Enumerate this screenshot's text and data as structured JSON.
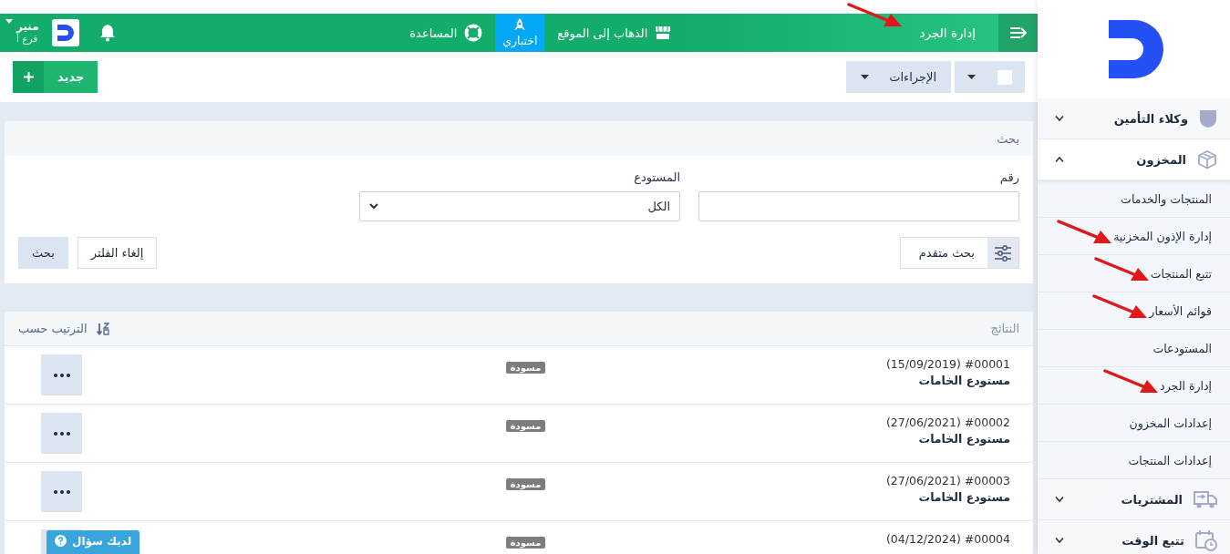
{
  "header": {
    "title": "إدارة الجرد",
    "title_marked": true,
    "site_link": "الذهاب إلى الموقع",
    "trial": "اختباري",
    "help": "المساعدة",
    "user": {
      "name": "منير",
      "branch": "فرع أ"
    }
  },
  "toolbar": {
    "select_all": {
      "checked": false
    },
    "actions": "الإجراءات",
    "new_button": "جديد"
  },
  "search": {
    "title": "بحث",
    "fields": [
      {
        "kind": "text",
        "label": "رقم"
      },
      {
        "kind": "select",
        "label": "المستودع",
        "value": "الكل"
      }
    ],
    "advanced": "بحث متقدم",
    "clear": "إلغاء الفلتر",
    "submit": "بحث"
  },
  "results": {
    "title": "النتائج",
    "sort": "الترتيب حسب",
    "rows": [
      {
        "number": "#00001 (15/09/2019)",
        "warehouse": "مستودع الخامات",
        "status": "مسودة"
      },
      {
        "number": "#00002 (27/06/2021)",
        "warehouse": "مستودع الخامات",
        "status": "مسودة"
      },
      {
        "number": "#00003 (27/06/2021)",
        "warehouse": "مستودع الخامات",
        "status": "مسودة"
      },
      {
        "number": "#00004 (04/12/2024)",
        "status": "مسودة"
      }
    ]
  },
  "help_button": "لديك سؤال",
  "sidebar": {
    "items": [
      {
        "label": "وكلاء التأمين",
        "kind": "shield",
        "expanded": false
      },
      {
        "label": "المخزون",
        "kind": "box",
        "expanded": true,
        "children": [
          {
            "label": "المنتجات والخدمات",
            "marked": false
          },
          {
            "label": "إدارة الإذون المخزنية",
            "marked": true
          },
          {
            "label": "تتبع المنتجات",
            "marked": true
          },
          {
            "label": "قوائم الأسعار",
            "marked": true
          },
          {
            "label": "المستودعات",
            "marked": false
          },
          {
            "label": "إدارة الجرد",
            "marked": true
          },
          {
            "label": "إعدادات المخزون",
            "marked": false
          },
          {
            "label": "إعدادات المنتجات",
            "marked": false
          }
        ]
      },
      {
        "label": "المشتريات",
        "kind": "truck",
        "expanded": false
      },
      {
        "label": "تتبع الوقت",
        "kind": "calendar",
        "expanded": false
      }
    ]
  }
}
